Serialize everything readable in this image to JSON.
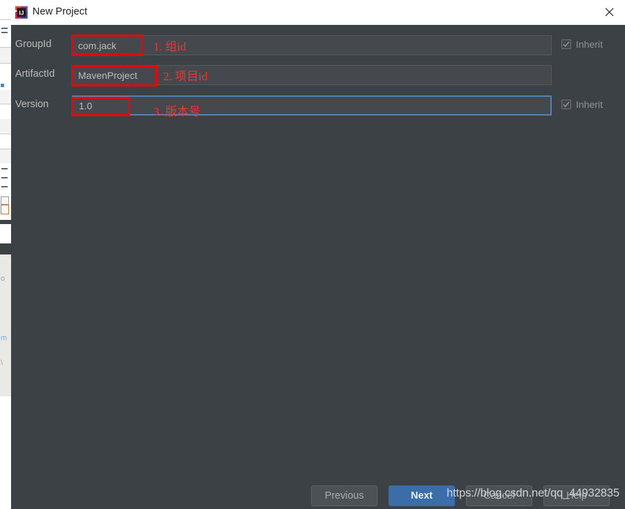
{
  "window": {
    "title": "New Project",
    "app_icon": "intellij-idea-icon",
    "close_icon": "close-icon"
  },
  "form": {
    "rows": [
      {
        "label": "GroupId",
        "value": "com.jack",
        "focused": false,
        "inherit": {
          "label": "Inherit",
          "checked": true,
          "visible": true
        }
      },
      {
        "label": "ArtifactId",
        "value": "MavenProject",
        "focused": false,
        "inherit": {
          "label": "",
          "checked": false,
          "visible": false
        }
      },
      {
        "label": "Version",
        "value": "1.0",
        "focused": true,
        "inherit": {
          "label": "Inherit",
          "checked": true,
          "visible": true
        }
      }
    ]
  },
  "annotations": [
    {
      "text": "1. 组id"
    },
    {
      "text": "2. 项目id"
    },
    {
      "text": "3. 版本号"
    }
  ],
  "footer": {
    "previous_label": "Previous",
    "next_label": "Next",
    "cancel_label": "Cancel",
    "help_label": "Help"
  },
  "watermark": {
    "text": "https://blog.csdn.net/qq_44932835"
  },
  "colors": {
    "dialog_bg": "#3c4145",
    "input_bg": "#45494d",
    "focus_border": "#5781b4",
    "primary_button": "#3b6ea8",
    "annotation_red": "#f50000",
    "titlebar_bg": "#ffffff"
  }
}
